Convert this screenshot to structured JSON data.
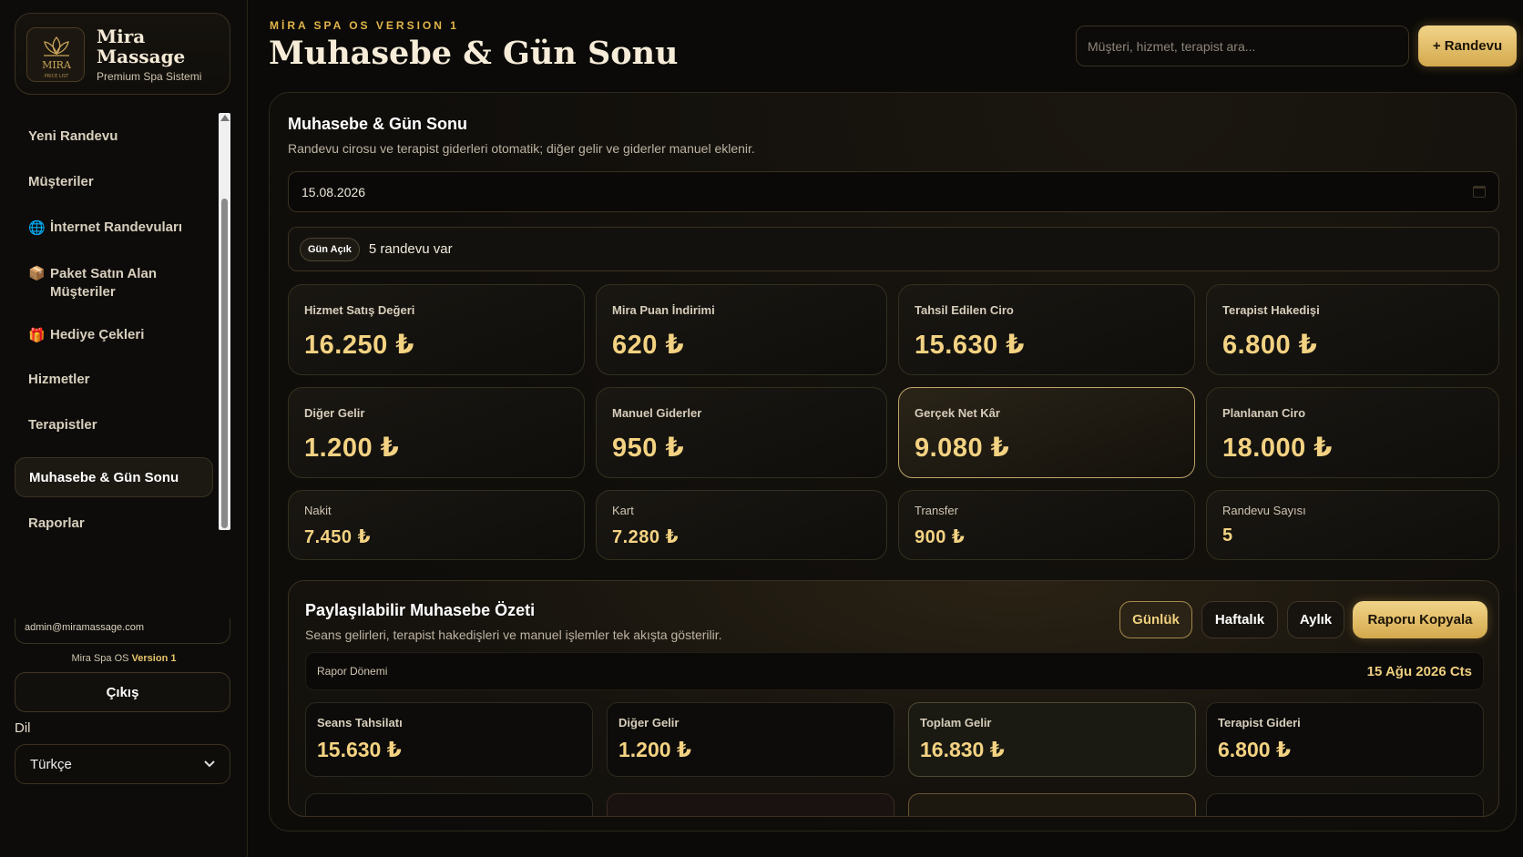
{
  "brand": {
    "title_line1": "Mira",
    "title_line2": "Massage",
    "subtitle": "Premium Spa Sistemi",
    "logo_text": "MIRA",
    "logo_subtext": "PRICE LIST"
  },
  "sidebar": {
    "items": [
      {
        "label": "Yeni Randevu",
        "icon": ""
      },
      {
        "label": "Müşteriler",
        "icon": ""
      },
      {
        "label": "İnternet Randevuları",
        "icon": "🌐"
      },
      {
        "label": "Paket Satın Alan Müşteriler",
        "icon": "📦"
      },
      {
        "label": "Hediye Çekleri",
        "icon": "🎁"
      },
      {
        "label": "Hizmetler",
        "icon": ""
      },
      {
        "label": "Terapistler",
        "icon": ""
      },
      {
        "label": "Muhasebe & Gün Sonu",
        "icon": ""
      },
      {
        "label": "Raporlar",
        "icon": ""
      }
    ],
    "active": "Muhasebe & Gün Sonu",
    "email": "admin@miramassage.com",
    "version_prefix": "Mira Spa OS",
    "version_label": "Version 1",
    "logout": "Çıkış",
    "language_label": "Dil",
    "language_value": "Türkçe"
  },
  "header": {
    "kicker": "MİRA SPA OS VERSION 1",
    "title": "Muhasebe & Gün Sonu",
    "search_placeholder": "Müşteri, hizmet, terapist ara...",
    "add_button": "+ Randevu"
  },
  "panel": {
    "title": "Muhasebe & Gün Sonu",
    "subtitle": "Randevu cirosu ve terapist giderleri otomatik; diğer gelir ve giderler manuel eklenir.",
    "date": "15.08.2026",
    "status_badge": "Gün Açık",
    "status_text": "5 randevu var"
  },
  "stats_row1": [
    {
      "label": "Hizmet Satış Değeri",
      "value": "16.250 ₺"
    },
    {
      "label": "Mira Puan İndirimi",
      "value": "620 ₺"
    },
    {
      "label": "Tahsil Edilen Ciro",
      "value": "15.630 ₺"
    },
    {
      "label": "Terapist Hakedişi",
      "value": "6.800 ₺"
    }
  ],
  "stats_row2": [
    {
      "label": "Diğer Gelir",
      "value": "1.200 ₺"
    },
    {
      "label": "Manuel Giderler",
      "value": "950 ₺"
    },
    {
      "label": "Gerçek Net Kâr",
      "value": "9.080 ₺"
    },
    {
      "label": "Planlanan Ciro",
      "value": "18.000 ₺"
    }
  ],
  "stats_row3": [
    {
      "label": "Nakit",
      "value": "7.450 ₺"
    },
    {
      "label": "Kart",
      "value": "7.280 ₺"
    },
    {
      "label": "Transfer",
      "value": "900 ₺"
    },
    {
      "label": "Randevu Sayısı",
      "value": "5"
    }
  ],
  "report": {
    "title": "Paylaşılabilir Muhasebe Özeti",
    "subtitle": "Seans gelirleri, terapist hakedişleri ve manuel işlemler tek akışta gösterilir.",
    "tabs": [
      "Günlük",
      "Haftalık",
      "Aylık"
    ],
    "active_tab": "Günlük",
    "copy_button": "Raporu Kopyala",
    "period_label": "Rapor Dönemi",
    "period_value": "15 Ağu 2026 Cts",
    "cards": [
      {
        "label": "Seans Tahsilatı",
        "value": "15.630 ₺"
      },
      {
        "label": "Diğer Gelir",
        "value": "1.200 ₺"
      },
      {
        "label": "Toplam Gelir",
        "value": "16.830 ₺"
      },
      {
        "label": "Terapist Gideri",
        "value": "6.800 ₺"
      }
    ]
  },
  "colors": {
    "accent": "#e2b54a",
    "value_gold": "#f3d282",
    "background": "#0b0a08"
  }
}
